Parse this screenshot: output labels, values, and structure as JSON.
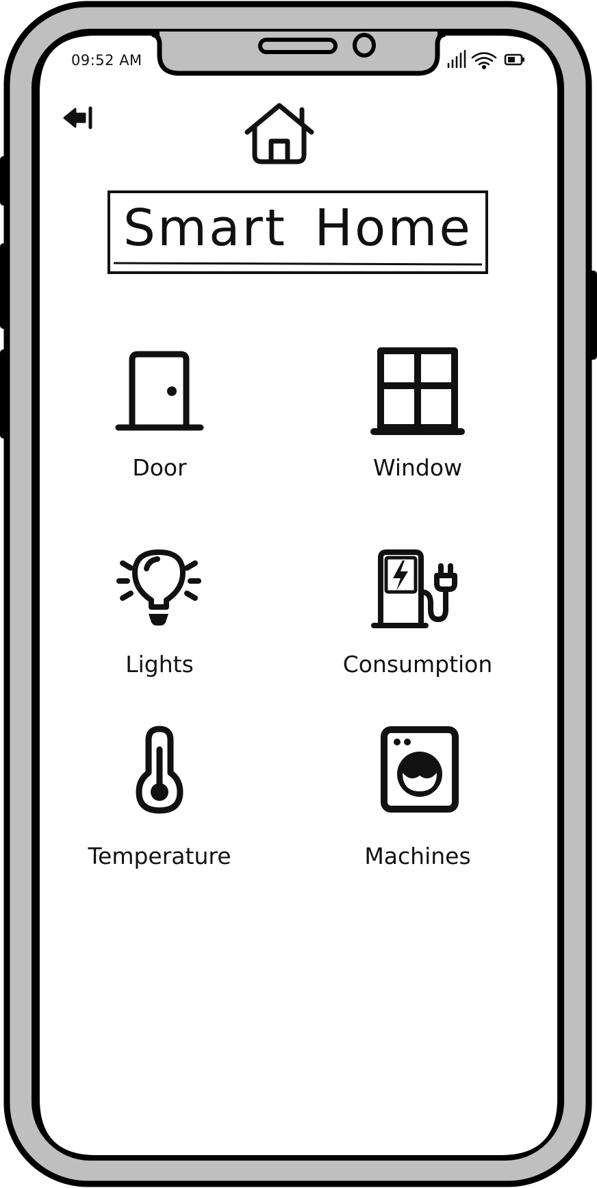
{
  "status_bar": {
    "time": "09:52 AM",
    "icons": [
      "signal-icon",
      "wifi-icon",
      "battery-icon"
    ]
  },
  "header": {
    "back_icon": "back-arrow-icon",
    "home_icon": "house-icon",
    "title": "Smart Home"
  },
  "menu": {
    "items": [
      {
        "label": "Door",
        "icon": "door-icon"
      },
      {
        "label": "Window",
        "icon": "window-icon"
      },
      {
        "label": "Lights",
        "icon": "light-bulb-icon"
      },
      {
        "label": "Consumption",
        "icon": "ev-charger-icon"
      },
      {
        "label": "Temperature",
        "icon": "thermometer-icon"
      },
      {
        "label": "Machines",
        "icon": "washing-machine-icon"
      }
    ]
  },
  "colors": {
    "frame": "#bfbfbf",
    "stroke": "#000000",
    "screen": "#ffffff"
  }
}
